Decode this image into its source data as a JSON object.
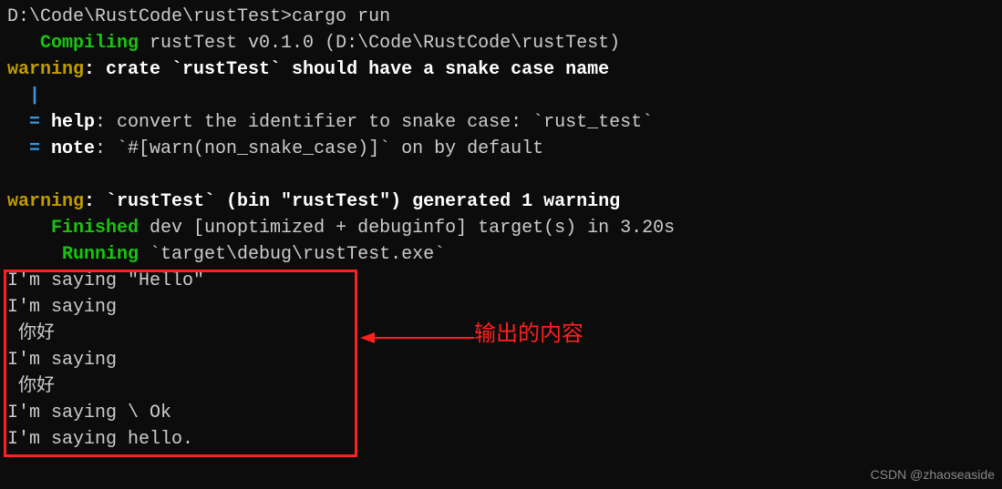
{
  "terminal": {
    "prompt_line": "D:\\Code\\RustCode\\rustTest>cargo run",
    "compiling_label": "   Compiling",
    "compiling_text": " rustTest v0.1.0 (D:\\Code\\RustCode\\rustTest)",
    "warning1_label": "warning",
    "warning1_text": ": crate `rustTest` should have a snake case name",
    "pipe_indent": "  |",
    "help_prefix": "  = ",
    "help_label": "help",
    "help_text": ": convert the identifier to snake case: `rust_test`",
    "note_prefix": "  = ",
    "note_label": "note",
    "note_text": ": `#[warn(non_snake_case)]` on by default",
    "warning2_label": "warning",
    "warning2_text": ": `rustTest` (bin \"rustTest\") generated 1 warning",
    "finished_label": "    Finished",
    "finished_text": " dev [unoptimized + debuginfo] target(s) in 3.20s",
    "running_label": "     Running",
    "running_text": " `target\\debug\\rustTest.exe`",
    "output": {
      "line1": "I'm saying \"Hello\"",
      "line2": "I'm saying",
      "line3": " 你好",
      "line4": "I'm saying",
      "line5": " 你好",
      "line6": "I'm saying \\ Ok",
      "line7": "I'm saying hello."
    }
  },
  "annotation": {
    "text": "输出的内容"
  },
  "watermark": "CSDN @zhaoseaside"
}
